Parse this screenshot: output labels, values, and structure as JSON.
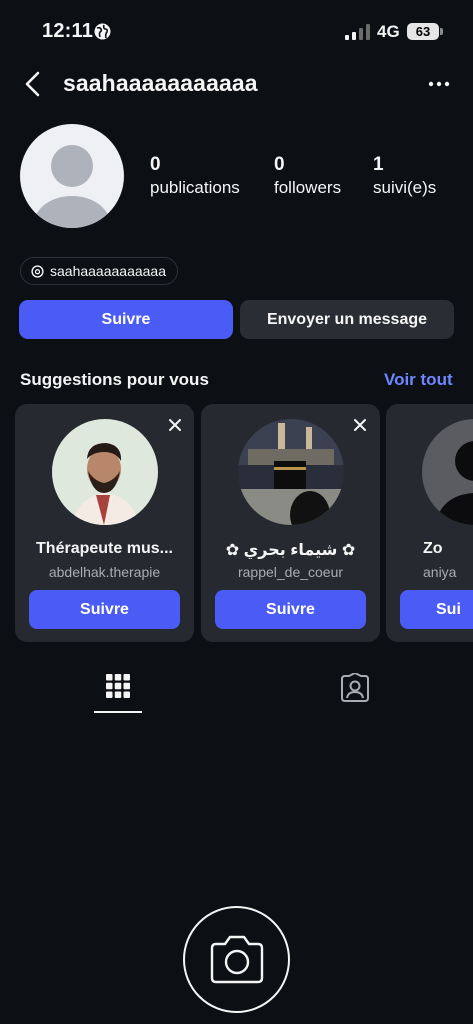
{
  "status_bar": {
    "time": "12:11",
    "network": "4G",
    "battery": "63"
  },
  "header": {
    "username": "saahaaaaaaaaaaa"
  },
  "profile": {
    "stats": [
      {
        "count": "0",
        "label": "publications"
      },
      {
        "count": "0",
        "label": "followers"
      },
      {
        "count": "1",
        "label": "suivi(e)s"
      }
    ],
    "threads_handle": "saahaaaaaaaaaaa",
    "follow_label": "Suivre",
    "message_label": "Envoyer un message"
  },
  "suggestions": {
    "title": "Suggestions pour vous",
    "see_all": "Voir tout",
    "cards": [
      {
        "name": "Thérapeute mus...",
        "handle": "abdelhak.therapie",
        "button": "Suivre"
      },
      {
        "name": "✿ شيماء بحري ✿",
        "handle": "rappel_de_coeur",
        "button": "Suivre"
      },
      {
        "name": "Zo",
        "handle": "aniya",
        "button": "Sui"
      }
    ]
  },
  "colors": {
    "background": "#0c0f14",
    "accent": "#4b5cf6",
    "link": "#6e86ff",
    "card": "#26292f"
  },
  "icons": [
    "globe-icon",
    "signal-icon",
    "back-arrow-icon",
    "more-dots-icon",
    "threads-icon",
    "close-icon",
    "grid-icon",
    "tagged-icon",
    "camera-icon"
  ]
}
